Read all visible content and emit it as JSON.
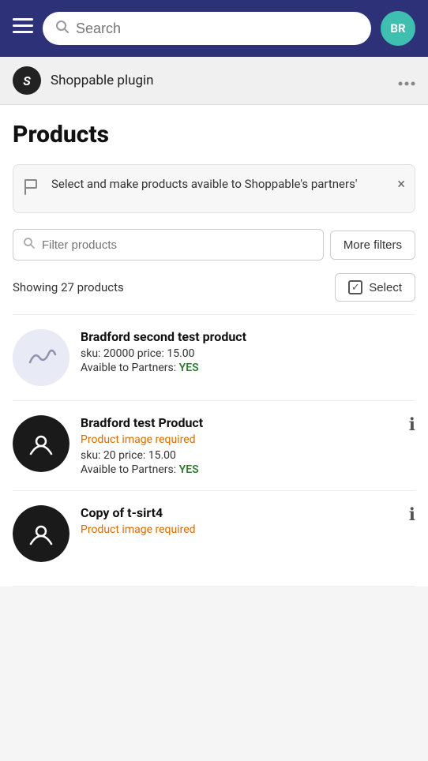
{
  "nav": {
    "search_placeholder": "Search",
    "avatar_initials": "BR",
    "avatar_bg": "#3ebfaf"
  },
  "plugin": {
    "name": "Shoppable plugin",
    "more_options_label": "..."
  },
  "page": {
    "title": "Products"
  },
  "banner": {
    "text": "Select and make products avaible to Shoppable's partners'",
    "close_label": "×"
  },
  "filter": {
    "placeholder": "Filter products",
    "more_filters_label": "More filters"
  },
  "showing": {
    "text": "Showing 27 products",
    "select_label": "Select"
  },
  "products": [
    {
      "id": 1,
      "name": "Bradford second test product",
      "sku_price": "sku: 20000 price: 15.00",
      "partners": "Avaible to Partners:",
      "available": "YES",
      "has_image": false,
      "image_required": false
    },
    {
      "id": 2,
      "name": "Bradford test Product",
      "sku_price": "sku: 20 price: 15.00",
      "partners": "Avaible to Partners:",
      "available": "YES",
      "has_image": true,
      "image_required": true,
      "image_required_text": "Product image required"
    },
    {
      "id": 3,
      "name": "Copy of t-sirt4",
      "sku_price": "",
      "partners": "",
      "available": "",
      "has_image": true,
      "image_required": true,
      "image_required_text": "Product image required"
    }
  ],
  "icons": {
    "hamburger": "☰",
    "search": "🔍",
    "flag": "⚑",
    "close": "×",
    "more": "•••",
    "info": "ℹ",
    "check": "✓"
  }
}
